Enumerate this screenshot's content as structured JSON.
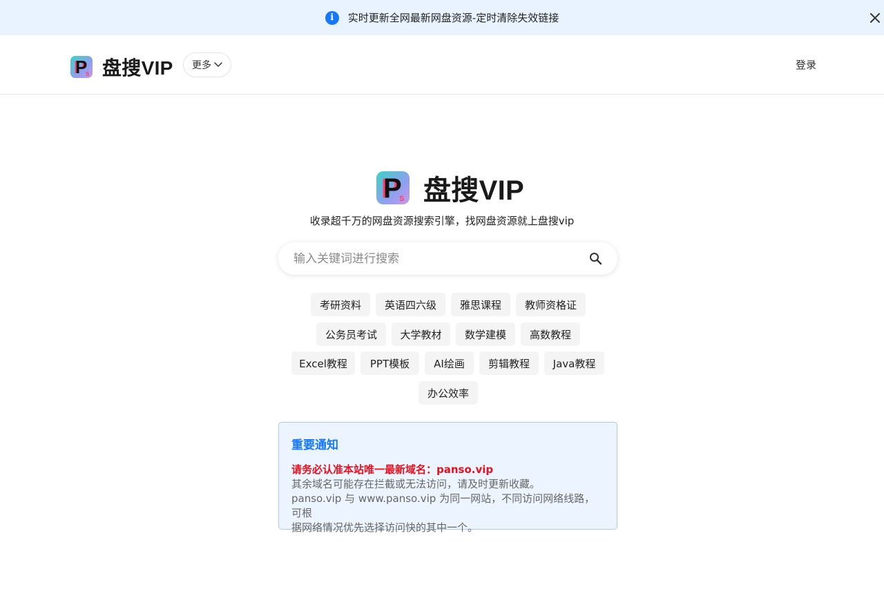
{
  "announcement": {
    "text": "实时更新全网最新网盘资源-定时清除失效链接",
    "icon": "info-icon",
    "close_icon": "close-icon"
  },
  "header": {
    "brand_name": "盘搜VIP",
    "more_label": "更多",
    "login_label": "登录"
  },
  "hero": {
    "brand_name": "盘搜VIP",
    "tagline": "收录超千万的网盘资源搜索引擎，找网盘资源就上盘搜vip"
  },
  "search": {
    "placeholder": "输入关键词进行搜索",
    "value": ""
  },
  "tags": [
    "考研资料",
    "英语四六级",
    "雅思课程",
    "教师资格证",
    "公务员考试",
    "大学教材",
    "数学建模",
    "高数教程",
    "Excel教程",
    "PPT模板",
    "AI绘画",
    "剪辑教程",
    "Java教程",
    "办公效率"
  ],
  "notice": {
    "title": "重要通知",
    "highlight": "请务必认准本站唯一最新域名：panso.vip",
    "line1": "其余域名可能存在拦截或无法访问，请及时更新收藏。",
    "line2": "panso.vip 与 www.panso.vip 为同一网站，不同访问网络线路，可根",
    "line3": "据网络情况优先选择访问快的其中一个。"
  },
  "colors": {
    "accent": "#1677ff",
    "announce_bg": "#e8f3ff",
    "notice_bg": "#ecf5ff",
    "notice_border": "#a8cdf3",
    "warning": "#e8101e",
    "tag_bg": "#f4f4f5"
  }
}
